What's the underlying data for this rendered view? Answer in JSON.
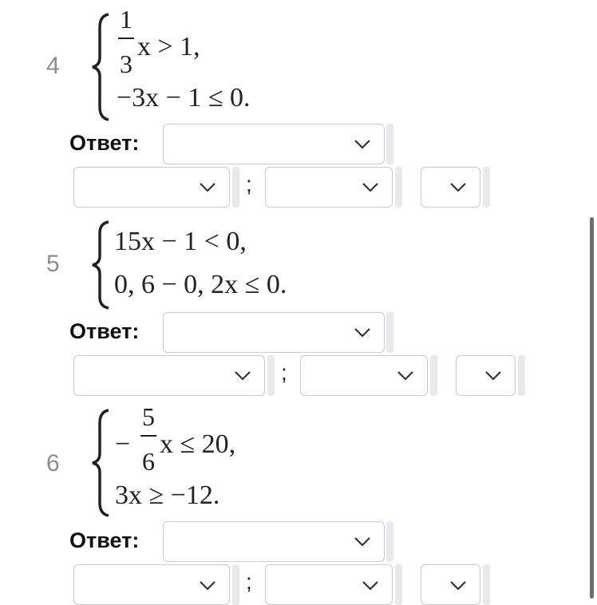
{
  "problems": [
    {
      "number": "4",
      "line1": {
        "num": "1",
        "den": "3",
        "rest": "x > 1,"
      },
      "line2": "−3x − 1 ≤ 0.",
      "answer_label": "Ответ:",
      "separator": ";"
    },
    {
      "number": "5",
      "line1": "15x − 1 < 0,",
      "line2": "0, 6 − 0, 2x ≤ 0.",
      "answer_label": "Ответ:",
      "separator": ";"
    },
    {
      "number": "6",
      "line1": {
        "sign": "−",
        "num": "5",
        "den": "6",
        "rest": "x ≤ 20,"
      },
      "line2": "3x ≥ −12.",
      "answer_label": "Ответ:",
      "separator": ";"
    }
  ],
  "icons": {
    "dropdown": "chevron-down-icon"
  },
  "colors": {
    "border": "#c9c9c9",
    "number": "#8c8c8c",
    "scrollbar": "#6e6e6e"
  }
}
